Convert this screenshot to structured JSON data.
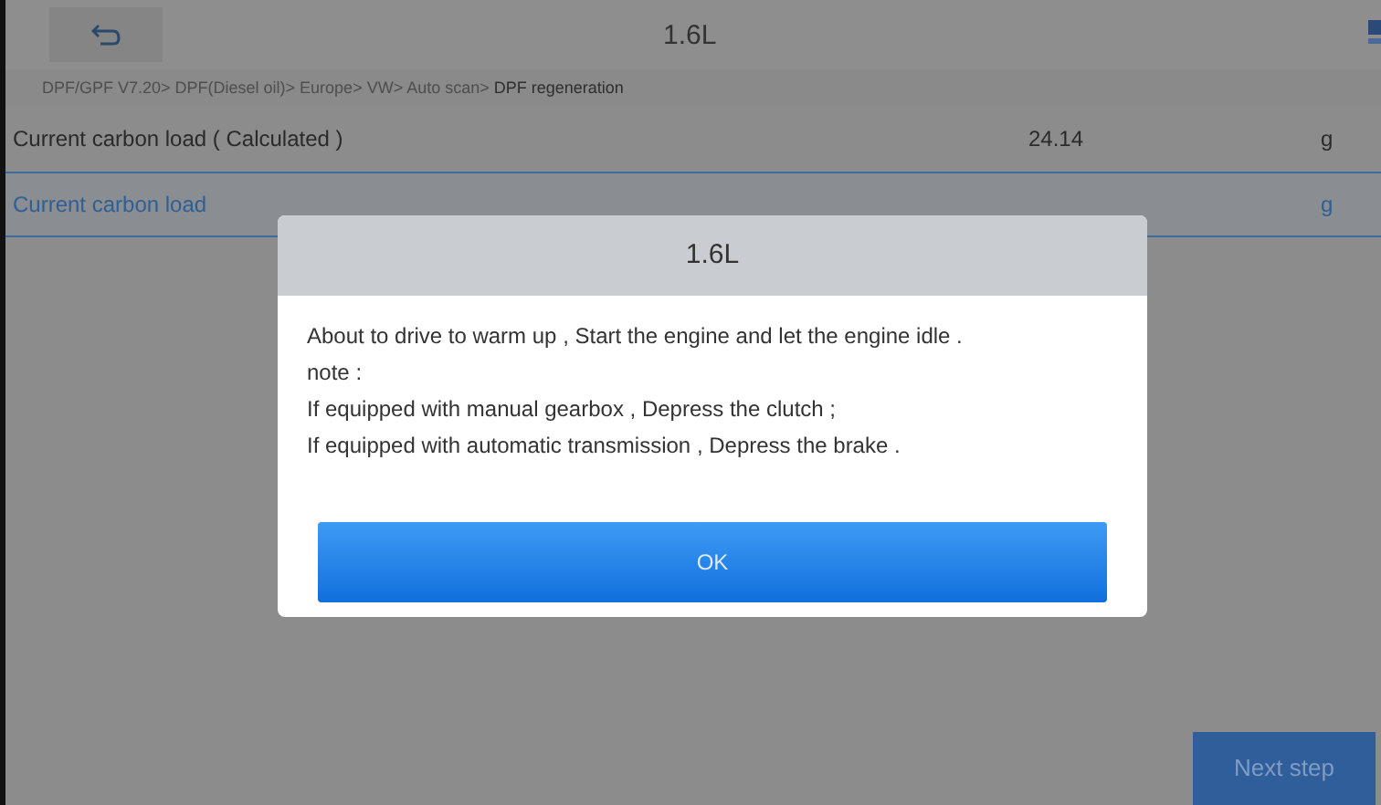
{
  "header": {
    "title": "1.6L"
  },
  "breadcrumb": {
    "path": "DPF/GPF V7.20> DPF(Diesel oil)> Europe> VW> Auto scan> ",
    "current": "DPF regeneration"
  },
  "rows": [
    {
      "name": "Current carbon load ( Calculated )",
      "value": "24.14",
      "unit": "g",
      "selected": false
    },
    {
      "name": "Current carbon load",
      "unit": "g",
      "selected": true
    }
  ],
  "next_button": "Next step",
  "dialog": {
    "title": "1.6L",
    "lines": [
      "About to drive to warm up , Start the engine and let the engine idle .",
      "note :",
      "If equipped with manual gearbox , Depress the clutch ;",
      "If equipped with automatic transmission , Depress the brake ."
    ],
    "button": "OK"
  }
}
